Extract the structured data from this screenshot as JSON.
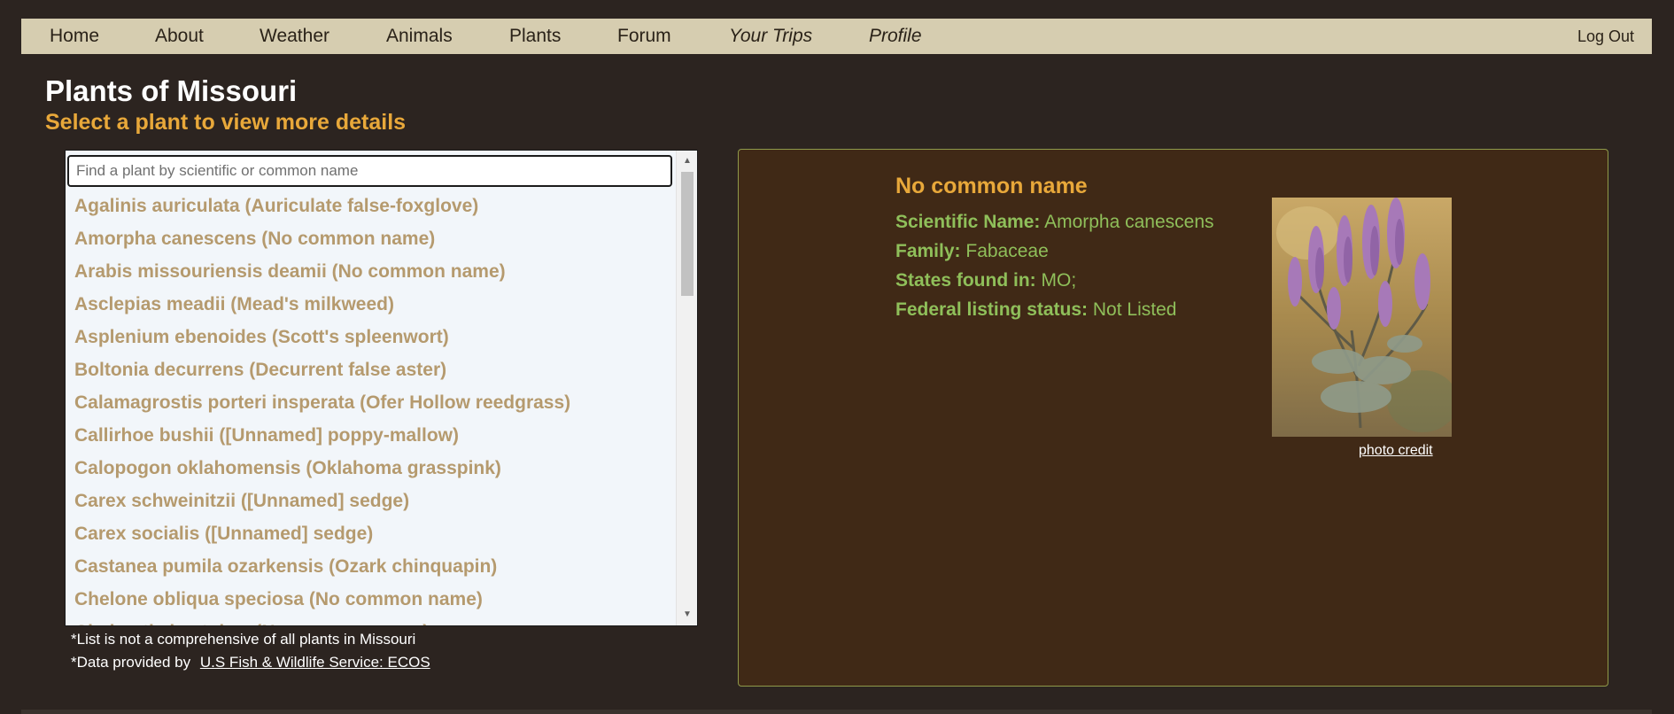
{
  "nav": {
    "items": [
      {
        "label": "Home"
      },
      {
        "label": "About"
      },
      {
        "label": "Weather"
      },
      {
        "label": "Animals"
      },
      {
        "label": "Plants"
      },
      {
        "label": "Forum"
      },
      {
        "label": "Your Trips"
      },
      {
        "label": "Profile"
      }
    ],
    "logout_label": "Log Out"
  },
  "page": {
    "title": "Plants of Missouri",
    "subtitle": "Select a plant to view more details"
  },
  "search": {
    "placeholder": "Find a plant by scientific or common name",
    "value": ""
  },
  "plant_list": [
    "Agalinis auriculata (Auriculate false-foxglove)",
    "Amorpha canescens (No common name)",
    "Arabis missouriensis deamii (No common name)",
    "Asclepias meadii (Mead's milkweed)",
    "Asplenium ebenoides (Scott's spleenwort)",
    "Boltonia decurrens (Decurrent false aster)",
    "Calamagrostis porteri insperata (Ofer Hollow reedgrass)",
    "Callirhoe bushii ([Unnamed] poppy-mallow)",
    "Calopogon oklahomensis (Oklahoma grasspink)",
    "Carex schweinitzii ([Unnamed] sedge)",
    "Carex socialis ([Unnamed] sedge)",
    "Castanea pumila ozarkensis (Ozark chinquapin)",
    "Chelone obliqua speciosa (No common name)",
    "Cladrastis kentukea (No common name)"
  ],
  "notes": {
    "line1": "*List is not a comprehensive of all plants in Missouri",
    "line2_prefix": "*Data provided by",
    "link_label": "U.S Fish & Wildlife Service: ECOS"
  },
  "detail": {
    "common_name": "No common name",
    "scientific_label": "Scientific Name:",
    "scientific_value": "Amorpha canescens",
    "family_label": "Family:",
    "family_value": "Fabaceae",
    "states_label": "States found in:",
    "states_value": "MO;",
    "listing_label": "Federal listing status:",
    "listing_value": "Not Listed",
    "photo_credit": "photo credit"
  },
  "colors": {
    "background": "#2c2420",
    "nav_bg": "#d6cdb0",
    "accent_orange": "#e8a83a",
    "list_text": "#b59a6e",
    "detail_bg": "#402916",
    "detail_text": "#8fbf5a"
  }
}
